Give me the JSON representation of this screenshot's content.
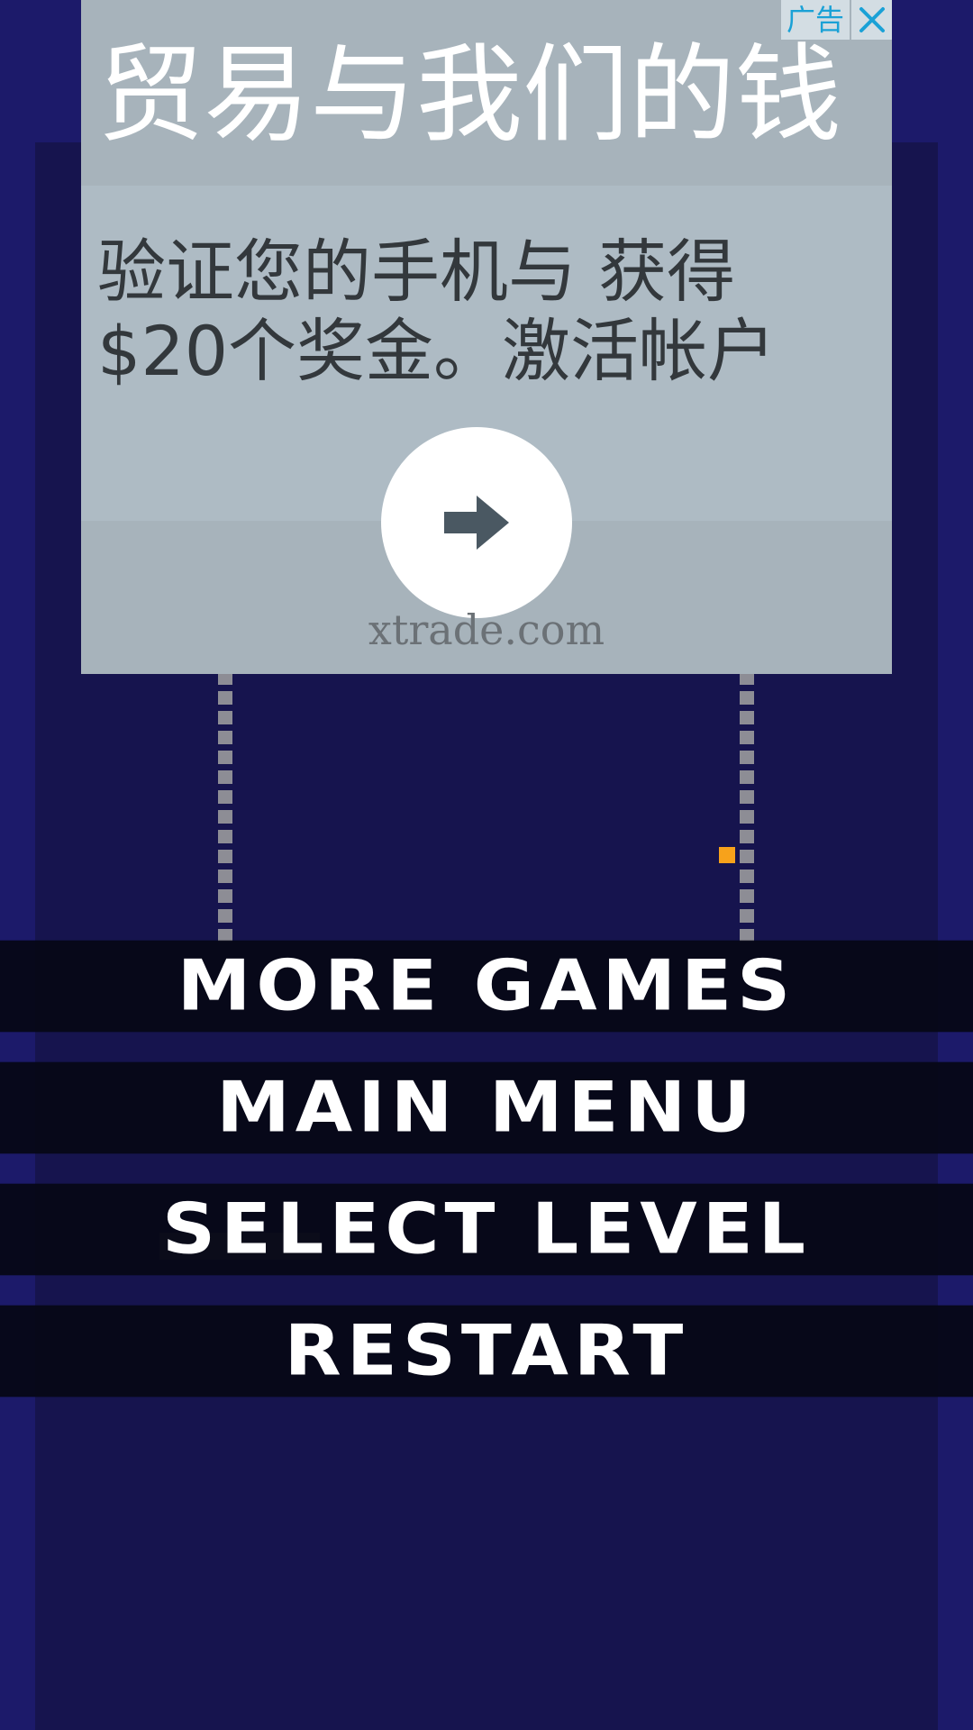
{
  "ad": {
    "label": "广告",
    "headline": "贸易与我们的钱",
    "body_line1": "验证您的手机与 获得",
    "body_line2": "$20个奖金。激活帐户",
    "domain": "xtrade.com",
    "cta_icon": "arrow-right-icon",
    "close_icon": "close-icon"
  },
  "menu": {
    "more_games": "MORE GAMES",
    "main_menu": "MAIN MENU",
    "select_level": "SELECT LEVEL",
    "restart": "RESTART"
  },
  "colors": {
    "background": "#1c1a6a",
    "play_area": "#16144e",
    "player": "#f7a21b",
    "wall": "#8d8d95",
    "ad_label_text": "#1aa1d6"
  }
}
